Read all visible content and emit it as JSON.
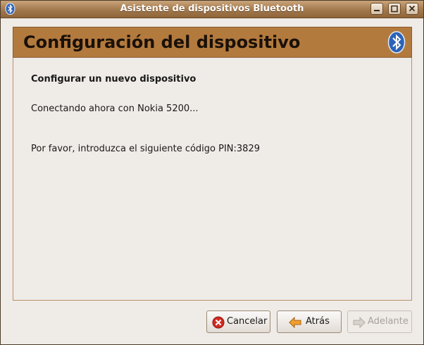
{
  "window": {
    "title": "Asistente de dispositivos Bluetooth",
    "icons": [
      "bluetooth-icon",
      "minimize-icon",
      "maximize-icon",
      "close-icon"
    ]
  },
  "banner": {
    "title": "Configuración del dispositivo",
    "icon": "bluetooth-icon"
  },
  "content": {
    "heading": "Configurar un nuevo dispositivo",
    "status": "Conectando ahora con Nokia 5200...",
    "pin_message": "Por favor, introduzca el siguiente código PIN:3829"
  },
  "buttons": {
    "cancel": {
      "label": "Cancelar",
      "icon": "cancel-icon"
    },
    "back": {
      "label": "Atrás",
      "icon": "arrow-left-icon"
    },
    "next": {
      "label": "Adelante",
      "icon": "arrow-right-icon",
      "enabled": false
    }
  },
  "colors": {
    "titlebar": "#a57b50",
    "banner": "#b37a3e",
    "background": "#efebe7",
    "bluetooth": "#2c63b8"
  }
}
